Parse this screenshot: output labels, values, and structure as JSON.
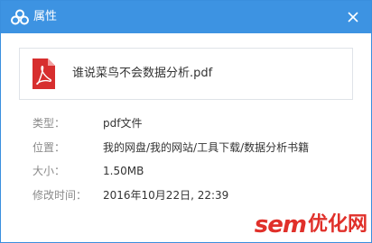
{
  "window": {
    "title": "属性",
    "icons": {
      "app": "cloud-icon",
      "close": "close-icon"
    }
  },
  "file": {
    "name": "谁说菜鸟不会数据分析.pdf",
    "icon": "pdf-file-icon"
  },
  "properties": [
    {
      "label": "类型：",
      "value": "pdf文件"
    },
    {
      "label": "位置：",
      "value": "我的网盘/我的网站/工具下载/数据分析书籍"
    },
    {
      "label": "大小：",
      "value": "1.50MB"
    },
    {
      "label": "修改时间：",
      "value": "2016年10月22日, 22:39"
    }
  ],
  "watermark": {
    "latin": "sem",
    "cjk": "优化网"
  },
  "colors": {
    "titlebar": "#3d93e2",
    "pdf_red": "#d72e2e",
    "watermark_red": "#e0302a"
  }
}
